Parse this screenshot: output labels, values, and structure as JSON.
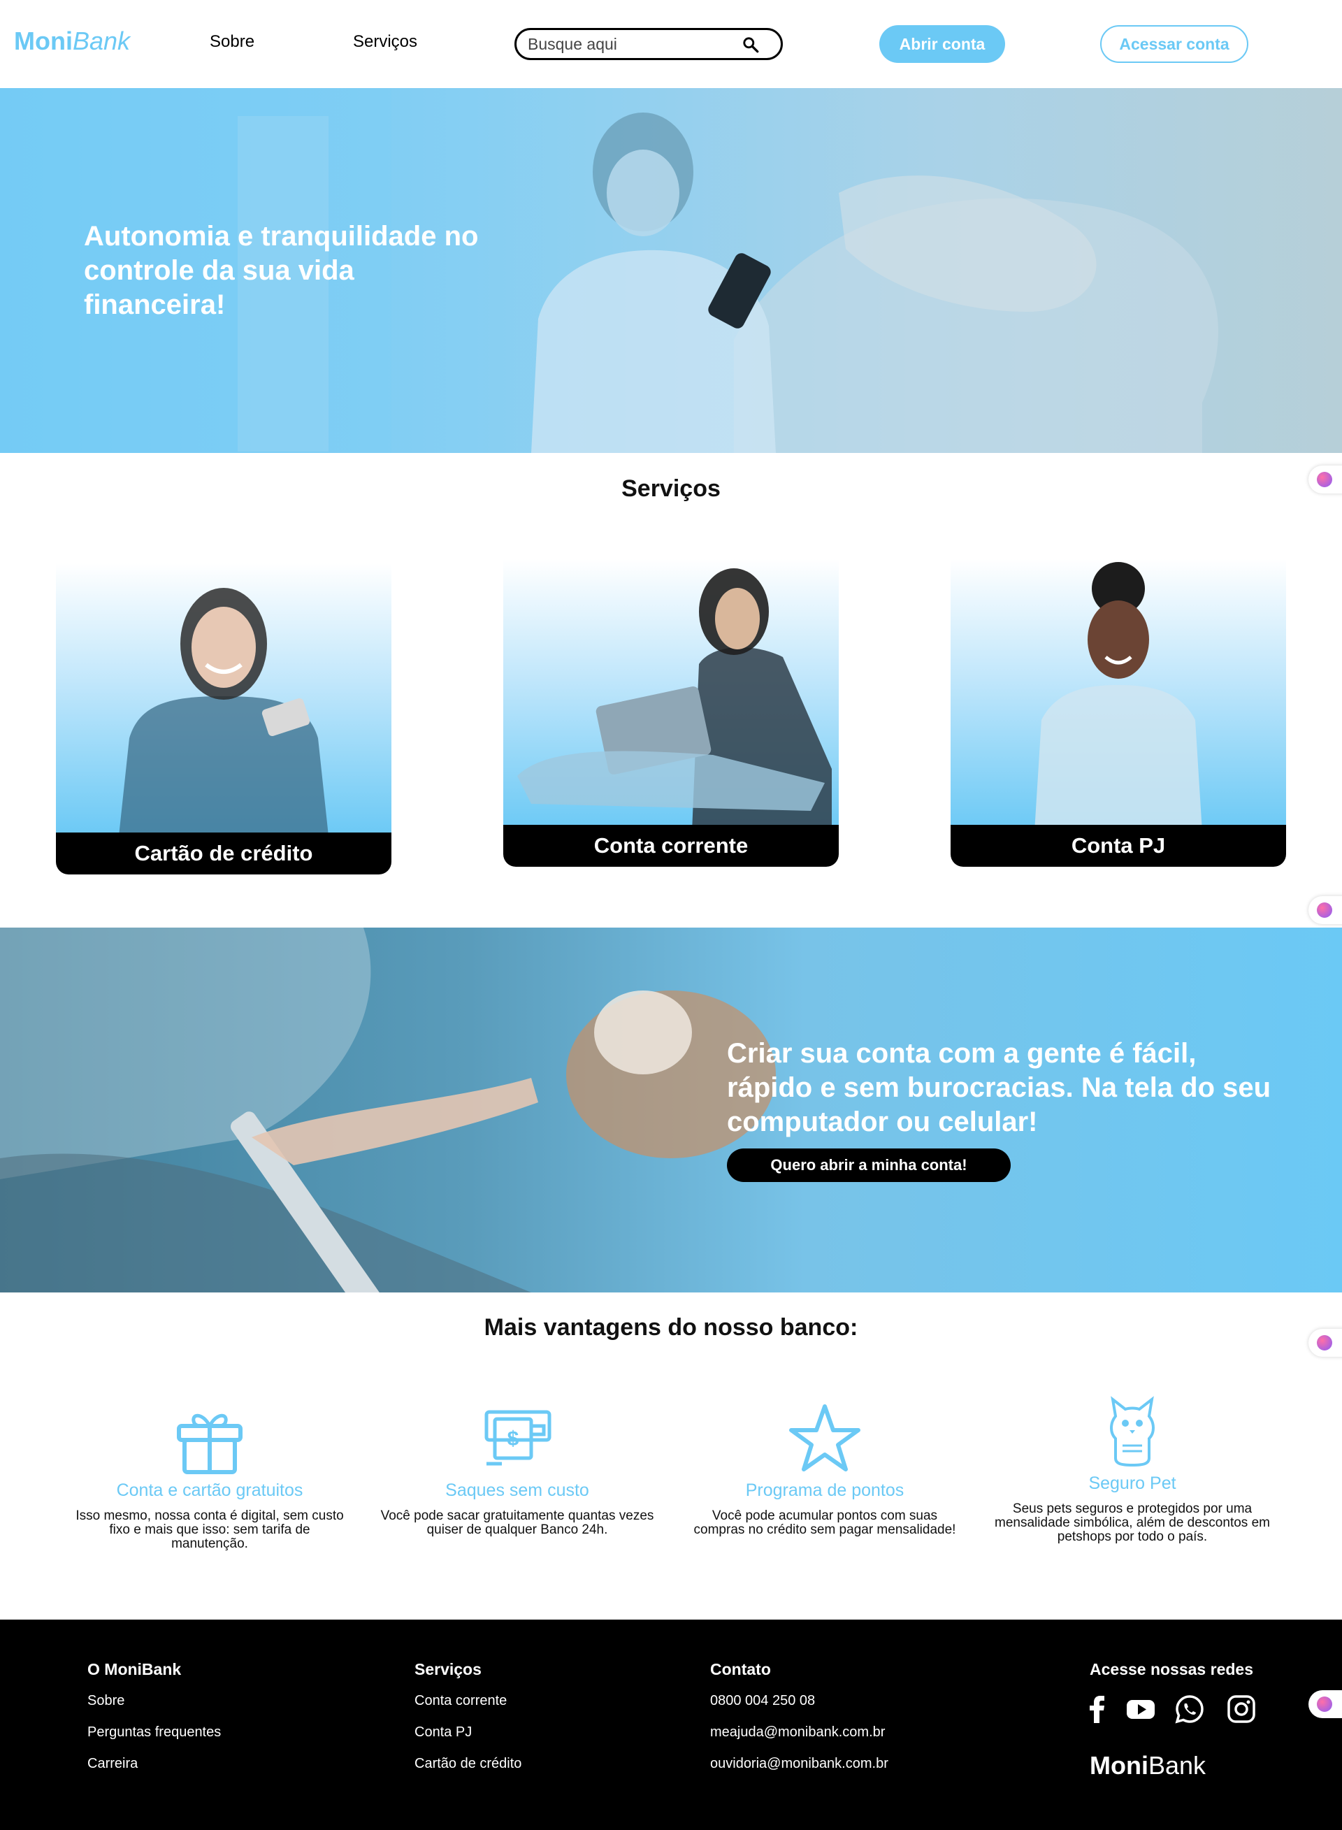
{
  "header": {
    "logo_bold": "Moni",
    "logo_italic": "Bank",
    "nav": [
      "Sobre",
      "Serviços"
    ],
    "search_placeholder": "Busque aqui",
    "open_account": "Abrir conta",
    "access_account": "Acessar conta"
  },
  "hero": {
    "title": "Autonomia e tranquilidade no controle da sua vida financeira!"
  },
  "services": {
    "title": "Serviços",
    "cards": [
      "Cartão de crédito",
      "Conta corrente",
      "Conta PJ"
    ]
  },
  "promo": {
    "title": "Criar sua conta com a gente é fácil, rápido e sem burocracias. Na tela do seu computador ou celular!",
    "button": "Quero abrir a minha conta!"
  },
  "advantages": {
    "title": "Mais vantagens do nosso banco:",
    "items": [
      {
        "icon": "gift-icon",
        "title": "Conta e cartão gratuitos",
        "text": "Isso mesmo, nossa conta é digital, sem custo fixo e mais que isso: sem tarifa de manutenção."
      },
      {
        "icon": "cash-withdraw-icon",
        "title": "Saques sem custo",
        "text": "Você pode sacar gratuitamente quantas vezes quiser de qualquer Banco 24h."
      },
      {
        "icon": "star-icon",
        "title": "Programa de pontos",
        "text": "Você pode acumular pontos com suas compras no crédito sem pagar mensalidade!"
      },
      {
        "icon": "cat-icon",
        "title": "Seguro Pet",
        "text": "Seus pets seguros e protegidos por uma mensalidade simbólica, além de descontos em petshops por todo o país."
      }
    ]
  },
  "footer": {
    "col1": {
      "title": "O MoniBank",
      "items": [
        "Sobre",
        "Perguntas frequentes",
        "Carreira"
      ]
    },
    "col2": {
      "title": "Serviços",
      "items": [
        "Conta corrente",
        "Conta PJ",
        "Cartão de crédito"
      ]
    },
    "col3": {
      "title": "Contato",
      "items": [
        "0800 004 250 08",
        "meajuda@monibank.com.br",
        "ouvidoria@monibank.com.br"
      ]
    },
    "social_title": "Acesse nossas redes",
    "social": [
      "facebook-icon",
      "youtube-icon",
      "whatsapp-icon",
      "instagram-icon"
    ],
    "logo_bold": "Moni",
    "logo_rest": "Bank"
  },
  "colors": {
    "accent": "#6bc9f5",
    "dark": "#000000",
    "white": "#ffffff"
  }
}
